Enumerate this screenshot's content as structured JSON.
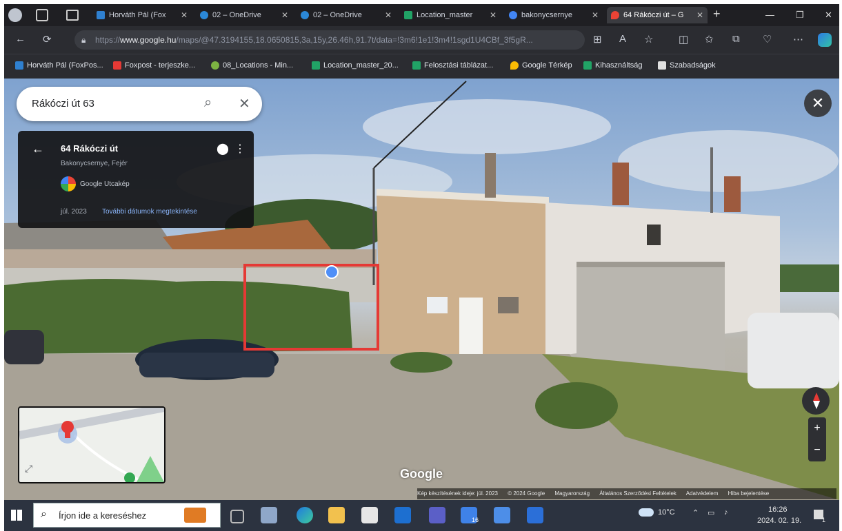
{
  "browser": {
    "tabs": [
      {
        "label": "Horváth Pál (Fox",
        "color": "#2f80d0"
      },
      {
        "label": "02 – OneDrive",
        "color": "#2b88d8"
      },
      {
        "label": "02 – OneDrive",
        "color": "#2b88d8"
      },
      {
        "label": "Location_master",
        "color": "#21a366"
      },
      {
        "label": "bakonycsernye",
        "color": "#4285f4"
      },
      {
        "label": "64 Rákóczi út – G",
        "color": "#ea4335"
      }
    ],
    "url_prefix": "https://",
    "url_host": "www.google.hu",
    "url_rest": "/maps/@47.3194155,18.0650815,3a,15y,26.46h,91.7t/data=!3m6!1e1!3m4!1sgd1U4CBf_3f5gR..."
  },
  "bookmarks": [
    {
      "label": "Horváth Pál (FoxPos...",
      "color": "#2f80d0"
    },
    {
      "label": "Foxpost - terjeszke...",
      "color": "#e53935"
    },
    {
      "label": "08_Locations - Min...",
      "color": "#7cb342"
    },
    {
      "label": "Location_master_20...",
      "color": "#21a366"
    },
    {
      "label": "Felosztási táblázat...",
      "color": "#21a366"
    },
    {
      "label": "Google Térkép",
      "color": "#fbbc04"
    },
    {
      "label": "Kihasználtság",
      "color": "#21a366"
    },
    {
      "label": "Szabadságok",
      "color": "#e0e0e0"
    }
  ],
  "search": {
    "value": "Rákóczi út 63"
  },
  "info_panel": {
    "title": "64 Rákóczi út",
    "subtitle": "Bakonycsernye, Fejér",
    "source": "Google Utcakép",
    "date": "júl. 2023",
    "more": "További dátumok megtekintése"
  },
  "map": {
    "logo": "Google"
  },
  "footer": {
    "items": [
      "Kép készítésének ideje: júl. 2023",
      "© 2024 Google",
      "Magyarország",
      "Általános Szerződési Feltételek",
      "Adatvédelem",
      "Hiba bejelentése"
    ]
  },
  "taskbar": {
    "search_placeholder": "Írjon ide a kereséshez",
    "weather": "10°C",
    "time": "16:26",
    "date": "2024. 02. 19.",
    "badge": "16",
    "notif": "1"
  }
}
